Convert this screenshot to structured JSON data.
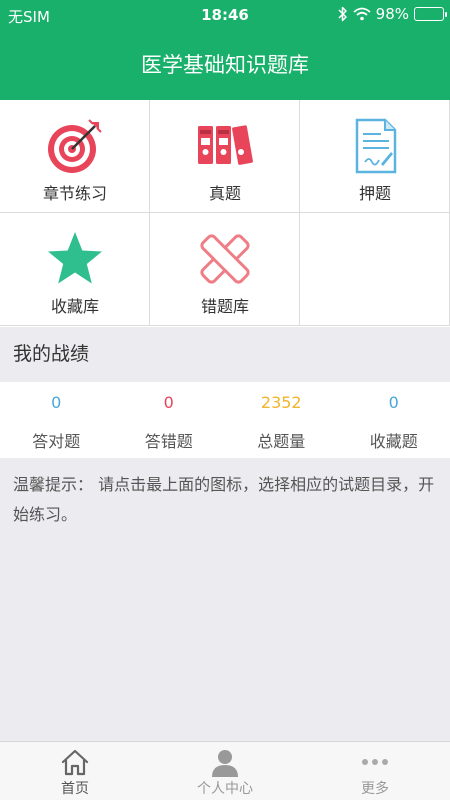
{
  "status_bar": {
    "carrier": "无SIM",
    "time": "18:46",
    "battery": "98%"
  },
  "header": {
    "title": "医学基础知识题库"
  },
  "menu": [
    {
      "label": "章节练习",
      "icon": "target-icon"
    },
    {
      "label": "真题",
      "icon": "binders-icon"
    },
    {
      "label": "押题",
      "icon": "document-icon"
    },
    {
      "label": "收藏库",
      "icon": "star-icon"
    },
    {
      "label": "错题库",
      "icon": "cross-icon"
    }
  ],
  "record": {
    "title": "我的战绩",
    "stats": [
      {
        "value": "0",
        "label": "答对题",
        "color": "#4aa7d9"
      },
      {
        "value": "0",
        "label": "答错题",
        "color": "#e8455a"
      },
      {
        "value": "2352",
        "label": "总题量",
        "color": "#f2b42a"
      },
      {
        "value": "0",
        "label": "收藏题",
        "color": "#4aa7d9"
      }
    ]
  },
  "tip": {
    "text": "温馨提示： 请点击最上面的图标，选择相应的试题目录，开始练习。"
  },
  "tabbar": [
    {
      "label": "首页",
      "icon": "home-icon"
    },
    {
      "label": "个人中心",
      "icon": "person-icon"
    },
    {
      "label": "更多",
      "icon": "more-icon"
    }
  ],
  "colors": {
    "brand": "#18b06a",
    "red": "#e8455a",
    "star": "#2fbe8d",
    "doc_blue": "#5bb3e0"
  }
}
